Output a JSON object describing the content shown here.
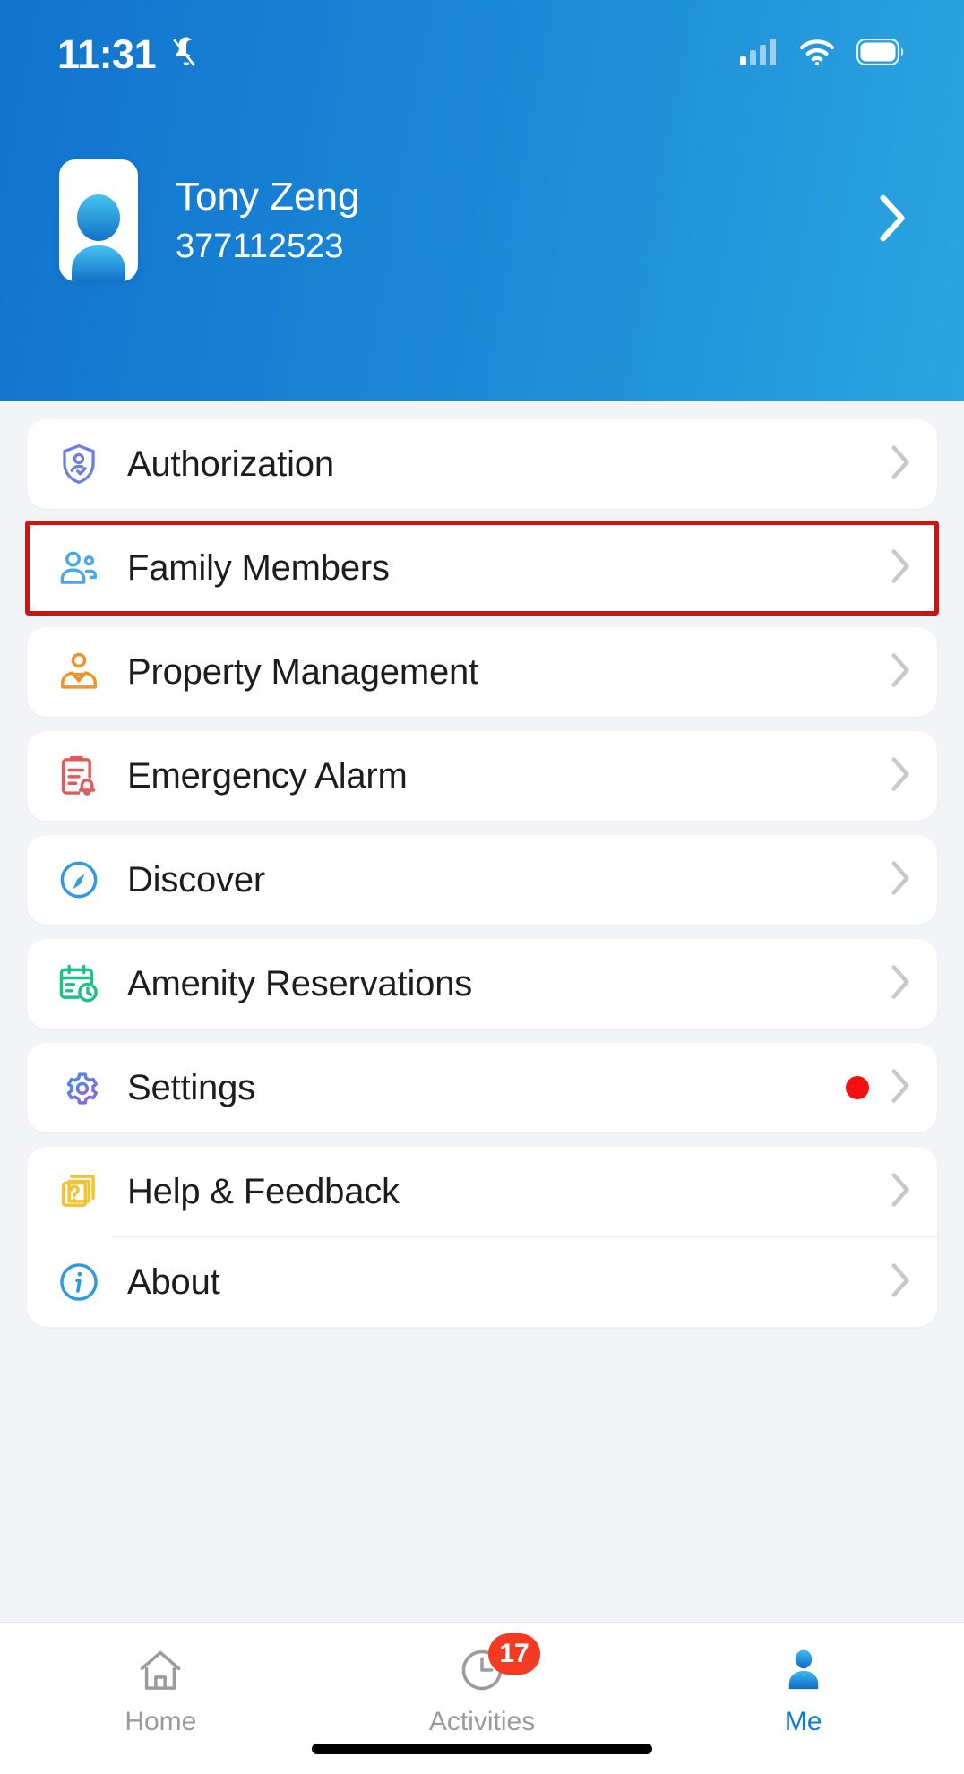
{
  "status_bar": {
    "time": "11:31",
    "icons": [
      "bell-muted-icon",
      "cellular-signal-icon",
      "wifi-icon",
      "battery-icon"
    ]
  },
  "header": {
    "avatar_icon": "user-avatar-icon",
    "name": "Tony Zeng",
    "user_id": "377112523",
    "chevron_icon": "chevron-right-icon",
    "gradient_from": "#1273ce",
    "gradient_to": "#2ba5e0"
  },
  "menu": {
    "groups": [
      {
        "items": [
          {
            "label": "Authorization",
            "icon": "shield-user-icon",
            "icon_color": "#6b7fe0",
            "chevron": "chevron-right-icon",
            "badge": false,
            "highlighted": false
          }
        ]
      },
      {
        "items": [
          {
            "label": "Family Members",
            "icon": "family-members-icon",
            "icon_color": "#4aa8e8",
            "chevron": "chevron-right-icon",
            "badge": false,
            "highlighted": true
          }
        ]
      },
      {
        "items": [
          {
            "label": "Property Management",
            "icon": "property-manager-icon",
            "icon_color": "#f0932b",
            "chevron": "chevron-right-icon",
            "badge": false,
            "highlighted": false
          }
        ]
      },
      {
        "items": [
          {
            "label": "Emergency Alarm",
            "icon": "emergency-alarm-icon",
            "icon_color": "#e05a5a",
            "chevron": "chevron-right-icon",
            "badge": false,
            "highlighted": false
          }
        ]
      },
      {
        "items": [
          {
            "label": "Discover",
            "icon": "compass-icon",
            "icon_color": "#2f9ae0",
            "chevron": "chevron-right-icon",
            "badge": false,
            "highlighted": false
          }
        ]
      },
      {
        "items": [
          {
            "label": "Amenity Reservations",
            "icon": "calendar-clock-icon",
            "icon_color": "#21c08b",
            "chevron": "chevron-right-icon",
            "badge": false,
            "highlighted": false
          }
        ]
      },
      {
        "items": [
          {
            "label": "Settings",
            "icon": "gear-icon",
            "icon_color": "#8a6ce0",
            "chevron": "chevron-right-icon",
            "badge": true,
            "badge_color": "#f50f0f",
            "highlighted": false
          }
        ]
      },
      {
        "items": [
          {
            "label": "Help & Feedback",
            "icon": "help-cards-icon",
            "icon_color": "#f2c32e",
            "chevron": "chevron-right-icon",
            "badge": false,
            "highlighted": false
          },
          {
            "label": "About",
            "icon": "info-circle-icon",
            "icon_color": "#2f9ae0",
            "chevron": "chevron-right-icon",
            "badge": false,
            "highlighted": false
          }
        ]
      }
    ]
  },
  "tabbar": {
    "tabs": [
      {
        "label": "Home",
        "icon": "house-icon",
        "active": false,
        "badge": ""
      },
      {
        "label": "Activities",
        "icon": "clock-icon",
        "active": false,
        "badge": "17"
      },
      {
        "label": "Me",
        "icon": "person-icon",
        "active": true,
        "badge": ""
      }
    ],
    "active_color": "#1379d6",
    "inactive_color": "#9a9a9f",
    "badge_color": "#f53a22"
  }
}
